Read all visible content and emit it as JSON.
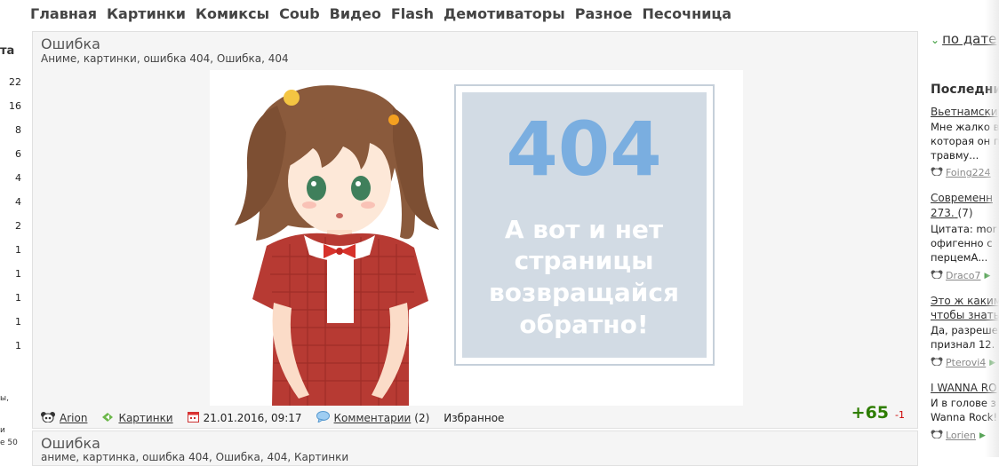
{
  "nav": [
    "Главная",
    "Картинки",
    "Комиксы",
    "Coub",
    "Видео",
    "Flash",
    "Демотиваторы",
    "Разное",
    "Песочница"
  ],
  "left": {
    "header": "та",
    "numbers": [
      "22",
      "16",
      "8",
      "6",
      "4",
      "4",
      "2",
      "1",
      "1",
      "1",
      "1",
      "1"
    ],
    "fragments": [
      "ы,",
      "и",
      "е 50"
    ]
  },
  "post": {
    "title": "Ошибка",
    "tags": "Аниме, картинки, ошибка 404, Ошибка, 404",
    "image": {
      "code": "404",
      "message_lines": [
        "А вот и нет",
        "страницы",
        "возвращайся",
        "обратно!"
      ]
    },
    "author": "Arion",
    "category": "Картинки",
    "date": "21.01.2016, 09:17",
    "comments_label": "Комментарии",
    "comments_count": "(2)",
    "favorite": "Избранное",
    "rating_pos": "+65",
    "rating_neg": "-1"
  },
  "post2": {
    "title": "Ошибка",
    "tags": "аниме, картинка, ошибка 404, Ошибка, 404, Картинки"
  },
  "sidebar": {
    "sort_label": "по дате",
    "heading": "Последни",
    "items": [
      {
        "title": "Вьетнамски",
        "lines": [
          "Мне жалко в",
          "которая он п",
          "травму..."
        ],
        "user": "Foing224"
      },
      {
        "title": "Современн",
        "title2": "273.",
        "count": "(7)",
        "lines": [
          "Цитата: mor",
          "офигенно с",
          "перцемА..."
        ],
        "user": "Draco7"
      },
      {
        "title": "Это ж каким",
        "title2": "чтобы знать",
        "lines": [
          "Да, разреше",
          "признал 12."
        ],
        "user": "Pterovi4"
      },
      {
        "title": "I WANNA RO",
        "lines": [
          "И в голове з",
          "Wanna Rock!"
        ],
        "user": "Lorien"
      }
    ]
  },
  "colors": {
    "accent_green": "#2e7d00",
    "negative_red": "#cc0000",
    "panel_bg": "#f5f5f5",
    "poster_bg": "#d2dbe4",
    "poster_404": "#7aaee0"
  }
}
